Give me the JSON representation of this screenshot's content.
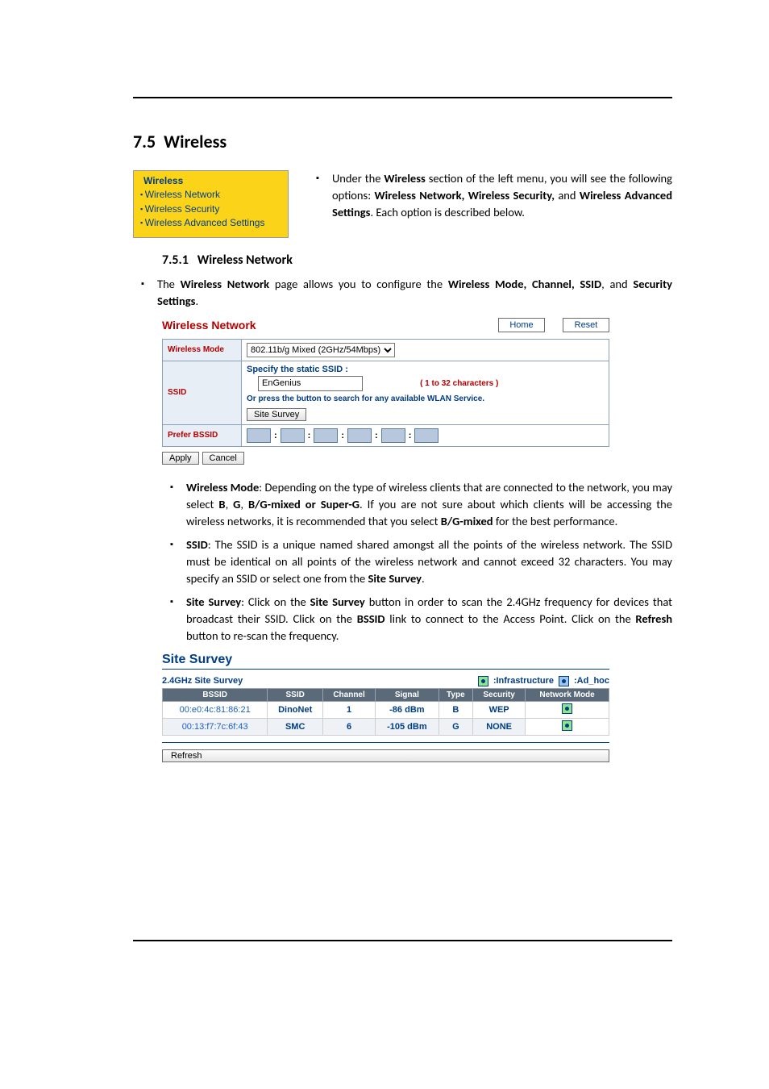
{
  "section_number": "7.5",
  "section_title": "Wireless",
  "menu": {
    "title": "Wireless",
    "items": [
      "Wireless Network",
      "Wireless Security",
      "Wireless Advanced Settings"
    ]
  },
  "intro": {
    "prefix": "Under the ",
    "bold1": "Wireless",
    "mid1": " section of the left menu, you will see the following options: ",
    "bold2": "Wireless Network, Wireless Security,",
    "mid2": " and ",
    "bold3": "Wireless Advanced Settings",
    "suffix": ". Each option is described below."
  },
  "subsection_number": "7.5.1",
  "subsection_title": "Wireless Network",
  "para1": {
    "p1": "The ",
    "b1": "Wireless Network",
    "p2": " page allows you to configure the ",
    "b2": "Wireless Mode, Channel, SSID",
    "p3": ", and ",
    "b3": "Security Settings",
    "p4": "."
  },
  "panel": {
    "title": "Wireless Network",
    "home": "Home",
    "reset": "Reset",
    "wireless_mode_label": "Wireless Mode",
    "wireless_mode_value": "802.11b/g Mixed (2GHz/54Mbps)",
    "ssid_label": "SSID",
    "ssid_specify": "Specify the static SSID :",
    "ssid_value": "EnGenius",
    "ssid_chars": "( 1 to 32 characters )",
    "ssid_or": "Or press the button to search for any available WLAN Service.",
    "site_survey_btn": "Site Survey",
    "prefer_label": "Prefer BSSID",
    "apply": "Apply",
    "cancel": "Cancel"
  },
  "desc": {
    "wm": {
      "b": "Wireless Mode",
      "t1": ": Depending on the type of wireless clients that are connected to the network, you may select ",
      "b2": "B",
      "c1": ", ",
      "b3": "G",
      "c2": ", ",
      "b4": "B/G-mixed or Super-G",
      "t2": ". If you are not sure about which clients will be accessing the wireless networks, it is recommended that you select ",
      "b5": "B/G-mixed",
      "t3": " for the best performance."
    },
    "ssid": {
      "b": "SSID",
      "t1": ": The SSID is a unique named shared amongst all the points of the wireless network. The SSID must be identical on all points of the wireless network and cannot exceed 32 characters. You may specify an SSID or select one from the ",
      "b2": "Site Survey",
      "t2": "."
    },
    "ss": {
      "b": "Site Survey",
      "t1": ": Click on the ",
      "b2": "Site Survey",
      "t2": " button in order to scan the 2.4GHz frequency for devices that broadcast their SSID. Click on the ",
      "b3": "BSSID",
      "t3": " link to connect to the Access Point. Click on the ",
      "b4": "Refresh",
      "t4": " button to re-scan the frequency."
    }
  },
  "site_survey": {
    "title": "Site Survey",
    "subtitle": "2.4GHz Site Survey",
    "legend_infra": ":Infrastructure",
    "legend_adhoc": ":Ad_hoc",
    "headers": [
      "BSSID",
      "SSID",
      "Channel",
      "Signal",
      "Type",
      "Security",
      "Network Mode"
    ],
    "rows": [
      {
        "bssid": "00:e0:4c:81:86:21",
        "ssid": "DinoNet",
        "channel": "1",
        "signal": "-86 dBm",
        "type": "B",
        "security": "WEP"
      },
      {
        "bssid": "00:13:f7:7c:6f:43",
        "ssid": "SMC",
        "channel": "6",
        "signal": "-105 dBm",
        "type": "G",
        "security": "NONE"
      }
    ],
    "refresh": "Refresh"
  }
}
